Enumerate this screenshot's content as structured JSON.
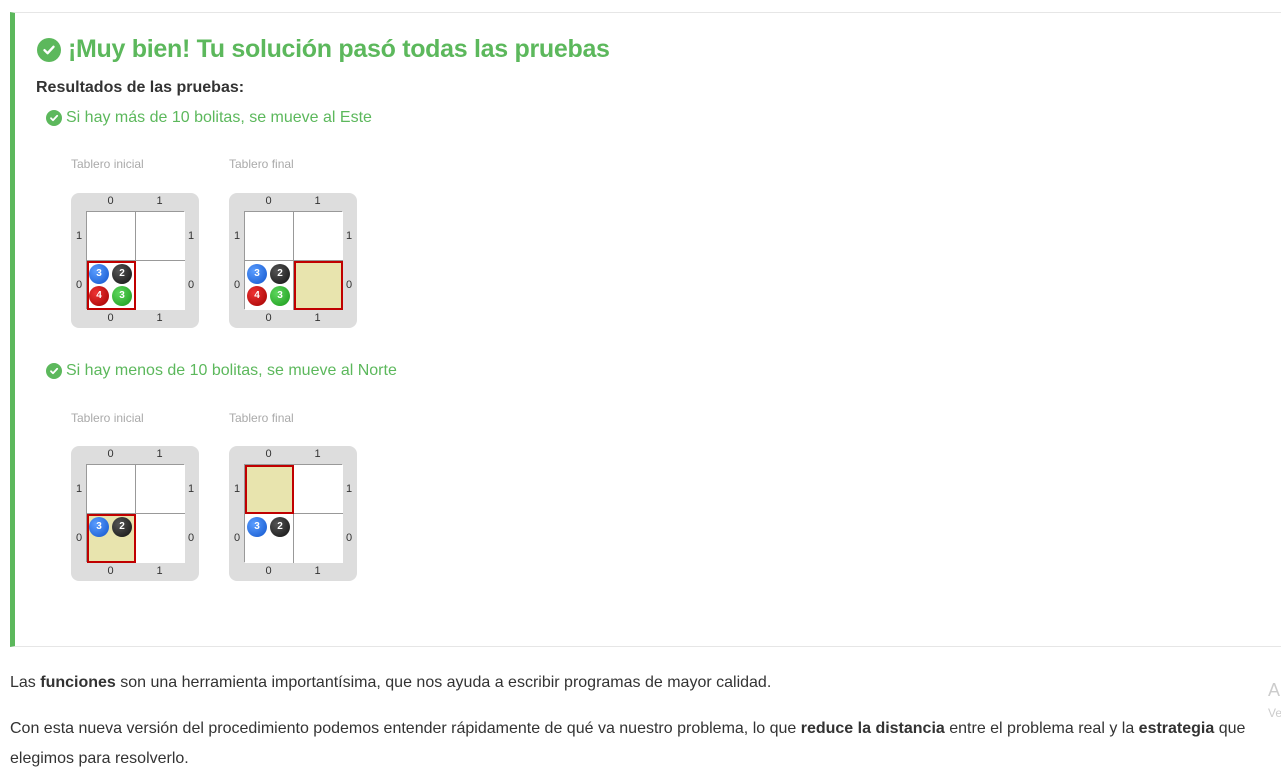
{
  "result": {
    "title": "¡Muy bien! Tu solución pasó todas las pruebas",
    "results_heading": "Resultados de las pruebas:",
    "tests": [
      {
        "title": "Si hay más de 10 bolitas, se mueve al Este",
        "initial_label": "Tablero inicial",
        "final_label": "Tablero final"
      },
      {
        "title": "Si hay menos de 10 bolitas, se mueve al Norte",
        "initial_label": "Tablero inicial",
        "final_label": "Tablero final"
      }
    ],
    "board_coords": {
      "col0": "0",
      "col1": "1",
      "row0": "0",
      "row1": "1"
    },
    "balls": {
      "blue": "3",
      "black": "2",
      "red": "4",
      "green": "3"
    },
    "colors": {
      "success": "#5cb85c",
      "head_cell": "#e8e4ae",
      "selected_border": "#c00000"
    }
  },
  "body_text": {
    "p1_a": "Las ",
    "p1_bold": "funciones",
    "p1_b": " son una herramienta importantísima, que nos ayuda a escribir programas de mayor calidad.",
    "p2_a": "Con esta nueva versión del procedimiento podemos entender rápidamente de qué va nuestro problema, lo que ",
    "p2_bold1": "reduce la distancia",
    "p2_b": " entre el problema real y la ",
    "p2_bold2": "estrategia",
    "p2_c": " que",
    "p2_line2": "elegimos para resolverlo."
  },
  "side_fragments": {
    "top": "A",
    "bottom": "Ve"
  }
}
